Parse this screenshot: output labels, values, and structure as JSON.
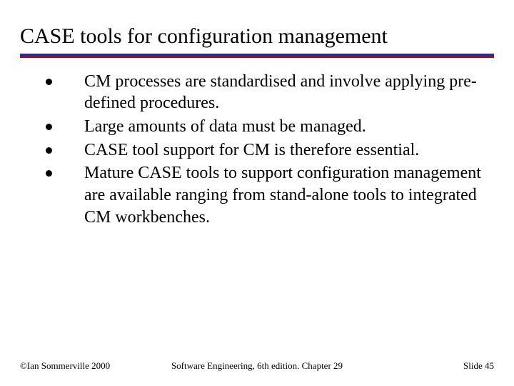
{
  "title": "CASE tools for configuration management",
  "bullets": [
    "CM processes are standardised and involve applying pre-defined procedures.",
    "Large amounts of data must be managed.",
    "CASE tool support for CM is therefore essential.",
    "Mature CASE tools to support configuration management are available ranging from stand-alone tools to integrated CM workbenches."
  ],
  "footer": {
    "left": "©Ian Sommerville 2000",
    "center": "Software Engineering, 6th edition. Chapter 29",
    "right": "Slide 45"
  },
  "colors": {
    "rule_top": "#2d2e83",
    "rule_bottom": "#c00000"
  }
}
